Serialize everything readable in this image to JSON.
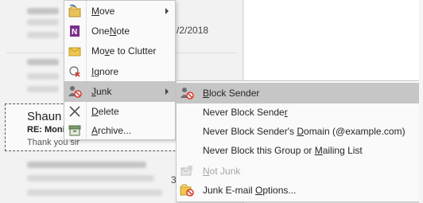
{
  "mail_list": {
    "rows": [
      {
        "date": "/2/2018"
      },
      {
        "date": ""
      }
    ],
    "selected": {
      "sender": "Shaun",
      "subject": "RE: Moni",
      "preview": "Thank you sir"
    },
    "row_number": "3"
  },
  "context_menu": {
    "items": [
      {
        "label_pre": "",
        "label_u": "M",
        "label_post": "ove",
        "has_submenu": true,
        "icon": "move-icon"
      },
      {
        "label_pre": "One",
        "label_u": "N",
        "label_post": "ote",
        "has_submenu": false,
        "icon": "onenote-icon"
      },
      {
        "label_pre": "Mo",
        "label_u": "v",
        "label_post": "e to Clutter",
        "has_submenu": false,
        "icon": "clutter-icon"
      },
      {
        "label_pre": "",
        "label_u": "I",
        "label_post": "gnore",
        "has_submenu": false,
        "icon": "ignore-icon"
      },
      {
        "label_pre": "",
        "label_u": "J",
        "label_post": "unk",
        "has_submenu": true,
        "icon": "junk-icon",
        "highlighted": true
      },
      {
        "label_pre": "",
        "label_u": "D",
        "label_post": "elete",
        "has_submenu": false,
        "icon": "delete-icon"
      },
      {
        "label_pre": "",
        "label_u": "A",
        "label_post": "rchive...",
        "has_submenu": false,
        "icon": "archive-icon"
      }
    ]
  },
  "junk_menu": {
    "items": [
      {
        "label_pre": "",
        "label_u": "B",
        "label_post": "lock Sender",
        "icon": "block-sender-icon",
        "highlighted": true,
        "disabled": false
      },
      {
        "label_pre": "Never Block Sende",
        "label_u": "r",
        "label_post": "",
        "icon": "",
        "disabled": false
      },
      {
        "label_pre": "Never Block Sender's ",
        "label_u": "D",
        "label_post": "omain (@example.com)",
        "icon": "",
        "disabled": false
      },
      {
        "label_pre": "Never Block this Group or ",
        "label_u": "M",
        "label_post": "ailing List",
        "icon": "",
        "disabled": false
      },
      {
        "label_pre": "",
        "label_u": "N",
        "label_post": "ot Junk",
        "icon": "not-junk-icon",
        "disabled": true
      },
      {
        "label_pre": "Junk E-mail ",
        "label_u": "O",
        "label_post": "ptions...",
        "icon": "junk-options-icon",
        "disabled": false
      }
    ]
  },
  "colors": {
    "highlight": "#c6c6c6",
    "menu_bg": "#fafafa",
    "disabled_text": "#a6a6a6",
    "onenote_purple": "#7b2e8c",
    "block_red": "#d9372b"
  }
}
